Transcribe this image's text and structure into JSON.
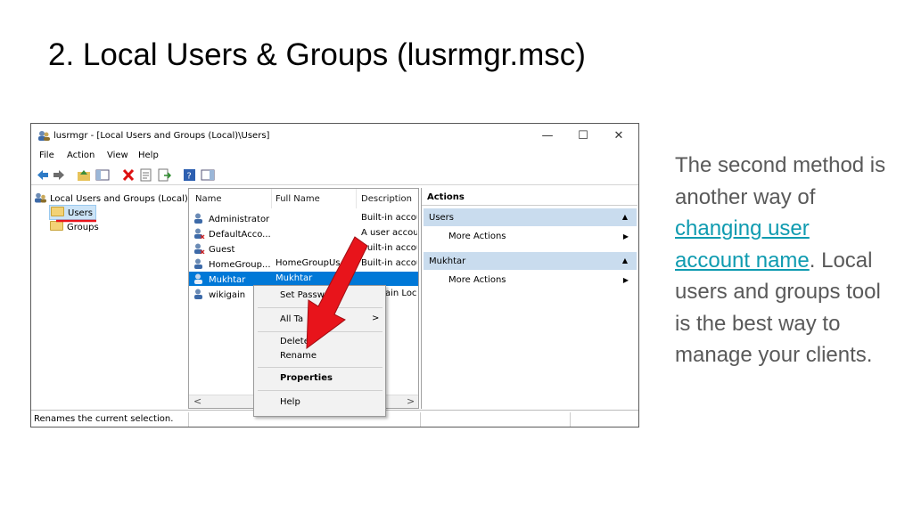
{
  "slide": {
    "title": "2. Local Users & Groups (lusrmgr.msc)",
    "text_before_link": "The second method is another way of ",
    "link_text": "changing user account name",
    "text_after_link": ". Local users and groups tool is the best way to manage your clients.",
    "link_color": "#0f9bb0"
  },
  "window": {
    "title": "lusrmgr - [Local Users and Groups (Local)\\Users]",
    "controls": {
      "minimize": "—",
      "maximize": "☐",
      "close": "✕"
    },
    "menu": [
      "File",
      "Action",
      "View",
      "Help"
    ],
    "toolbar_icons": [
      "back-arrow-icon",
      "forward-arrow-icon",
      "up-folder-icon",
      "show-hide-tree-icon",
      "delete-icon",
      "properties-icon",
      "export-list-icon",
      "help-icon",
      "action-pane-icon"
    ],
    "tree": {
      "root": "Local Users and Groups (Local)",
      "children": [
        "Users",
        "Groups"
      ],
      "selected": "Users"
    },
    "list": {
      "columns": [
        "Name",
        "Full Name",
        "Description"
      ],
      "rows": [
        {
          "name": "Administrator",
          "full_name": "",
          "description": "Built-in accou"
        },
        {
          "name": "DefaultAcco...",
          "full_name": "",
          "description": "A user accour"
        },
        {
          "name": "Guest",
          "full_name": "",
          "description": "Built-in accou"
        },
        {
          "name": "HomeGroup...",
          "full_name": "HomeGroupUs",
          "description": "Built-in accou"
        },
        {
          "name": "Mukhtar",
          "full_name": "Mukhtar",
          "description": ""
        },
        {
          "name": "wikigain",
          "full_name": "",
          "description": "ain Loc"
        }
      ],
      "selected": "Mukhtar",
      "scroll_left": "<",
      "scroll_right": ">"
    },
    "actions": {
      "header": "Actions",
      "sections": [
        {
          "title": "Users",
          "item": "More Actions"
        },
        {
          "title": "Mukhtar",
          "item": "More Actions"
        }
      ]
    },
    "context_menu": {
      "items": [
        "Set Passwo",
        "All Ta",
        "Delete",
        "Rename",
        "Properties",
        "Help"
      ],
      "submenu_arrow": ">"
    },
    "status": "Renames the current selection.",
    "accent": "#0078d7",
    "action_section_color": "#c9dcee",
    "annotation_color": "#e8141b"
  }
}
